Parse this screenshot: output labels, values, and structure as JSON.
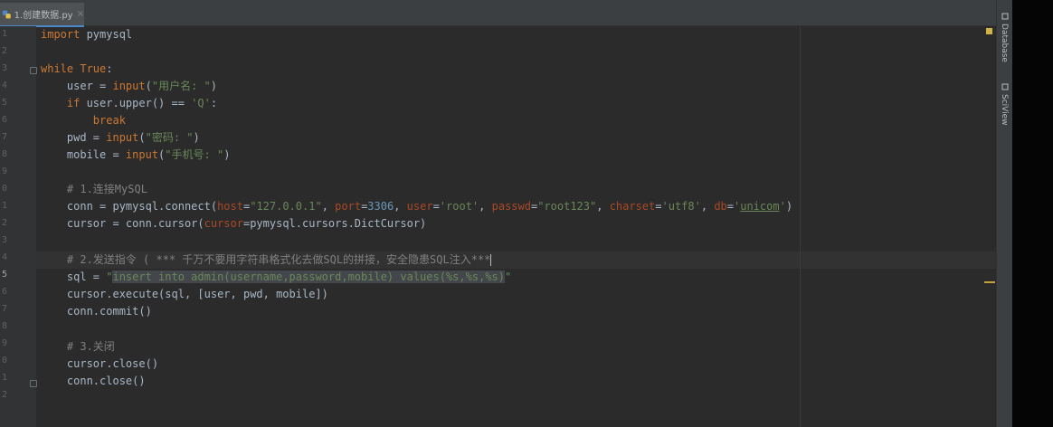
{
  "tab": {
    "label": "1.创建数据.py",
    "close": "×",
    "icon": "python-file-icon"
  },
  "line_numbers": [
    "1",
    "2",
    "3",
    "4",
    "5",
    "6",
    "7",
    "8",
    "9",
    "0",
    "1",
    "2",
    "3",
    "4",
    "5",
    "6",
    "7",
    "8",
    "9",
    "0",
    "1",
    "2"
  ],
  "code": {
    "l1_kw": "import",
    "l1_rest": " pymysql",
    "l3_kw": "while",
    "l3_true": " True",
    "l3_colon": ":",
    "l4_a": "    user = ",
    "l4_b": "input",
    "l4_c": "(",
    "l4_s": "\"用户名: \"",
    "l4_d": ")",
    "l5_kw": "    if",
    "l5_a": " user.upper() == ",
    "l5_s": "'Q'",
    "l5_b": ":",
    "l6_kw": "        break",
    "l7_a": "    pwd = ",
    "l7_b": "input",
    "l7_c": "(",
    "l7_s": "\"密码: \"",
    "l7_d": ")",
    "l8_a": "    mobile = ",
    "l8_b": "input",
    "l8_c": "(",
    "l8_s": "\"手机号: \"",
    "l8_d": ")",
    "l10_cm": "    # 1.连接MySQL",
    "l11_a": "    conn = pymysql.connect(",
    "l11_p1": "host",
    "l11_e1": "=",
    "l11_s1": "\"127.0.0.1\"",
    "l11_c1": ", ",
    "l11_p2": "port",
    "l11_e2": "=",
    "l11_n2": "3306",
    "l11_c2": ", ",
    "l11_p3": "user",
    "l11_e3": "=",
    "l11_s3": "'root'",
    "l11_c3": ", ",
    "l11_p4": "passwd",
    "l11_e4": "=",
    "l11_s4": "\"root123\"",
    "l11_c4": ", ",
    "l11_p5": "charset",
    "l11_e5": "=",
    "l11_s5": "'utf8'",
    "l11_c5": ", ",
    "l11_p6": "db",
    "l11_e6": "=",
    "l11_q6": "'",
    "l11_u6": "unicom",
    "l11_q6b": "'",
    "l11_end": ")",
    "l12_a": "    cursor = conn.cursor(",
    "l12_p": "cursor",
    "l12_b": "=pymysql.cursors.DictCursor)",
    "l14_cm": "    # 2.发送指令 ( *** 千万不要用字符串格式化去做SQL的拼接，安全隐患SQL注入***",
    "l15_a": "    sql = ",
    "l15_q": "\"",
    "l15_sel": "insert into admin(username,password,mobile) values(%s,%s,%s)",
    "l15_q2": "\"",
    "l16_a": "    cursor.execute(sql, [user, pwd, mobile])",
    "l17_a": "    conn.commit()",
    "l19_cm": "    # 3.关闭",
    "l20_a": "    cursor.close()",
    "l21_a": "    conn.close()"
  },
  "right_sidebar": {
    "database": "Database",
    "sciview": "SciView"
  },
  "colors": {
    "keyword": "#cc7832",
    "string": "#6a8759",
    "comment": "#808080",
    "param": "#aa4926",
    "number": "#6897bb",
    "text": "#a9b7c6",
    "background": "#2b2b2b"
  }
}
